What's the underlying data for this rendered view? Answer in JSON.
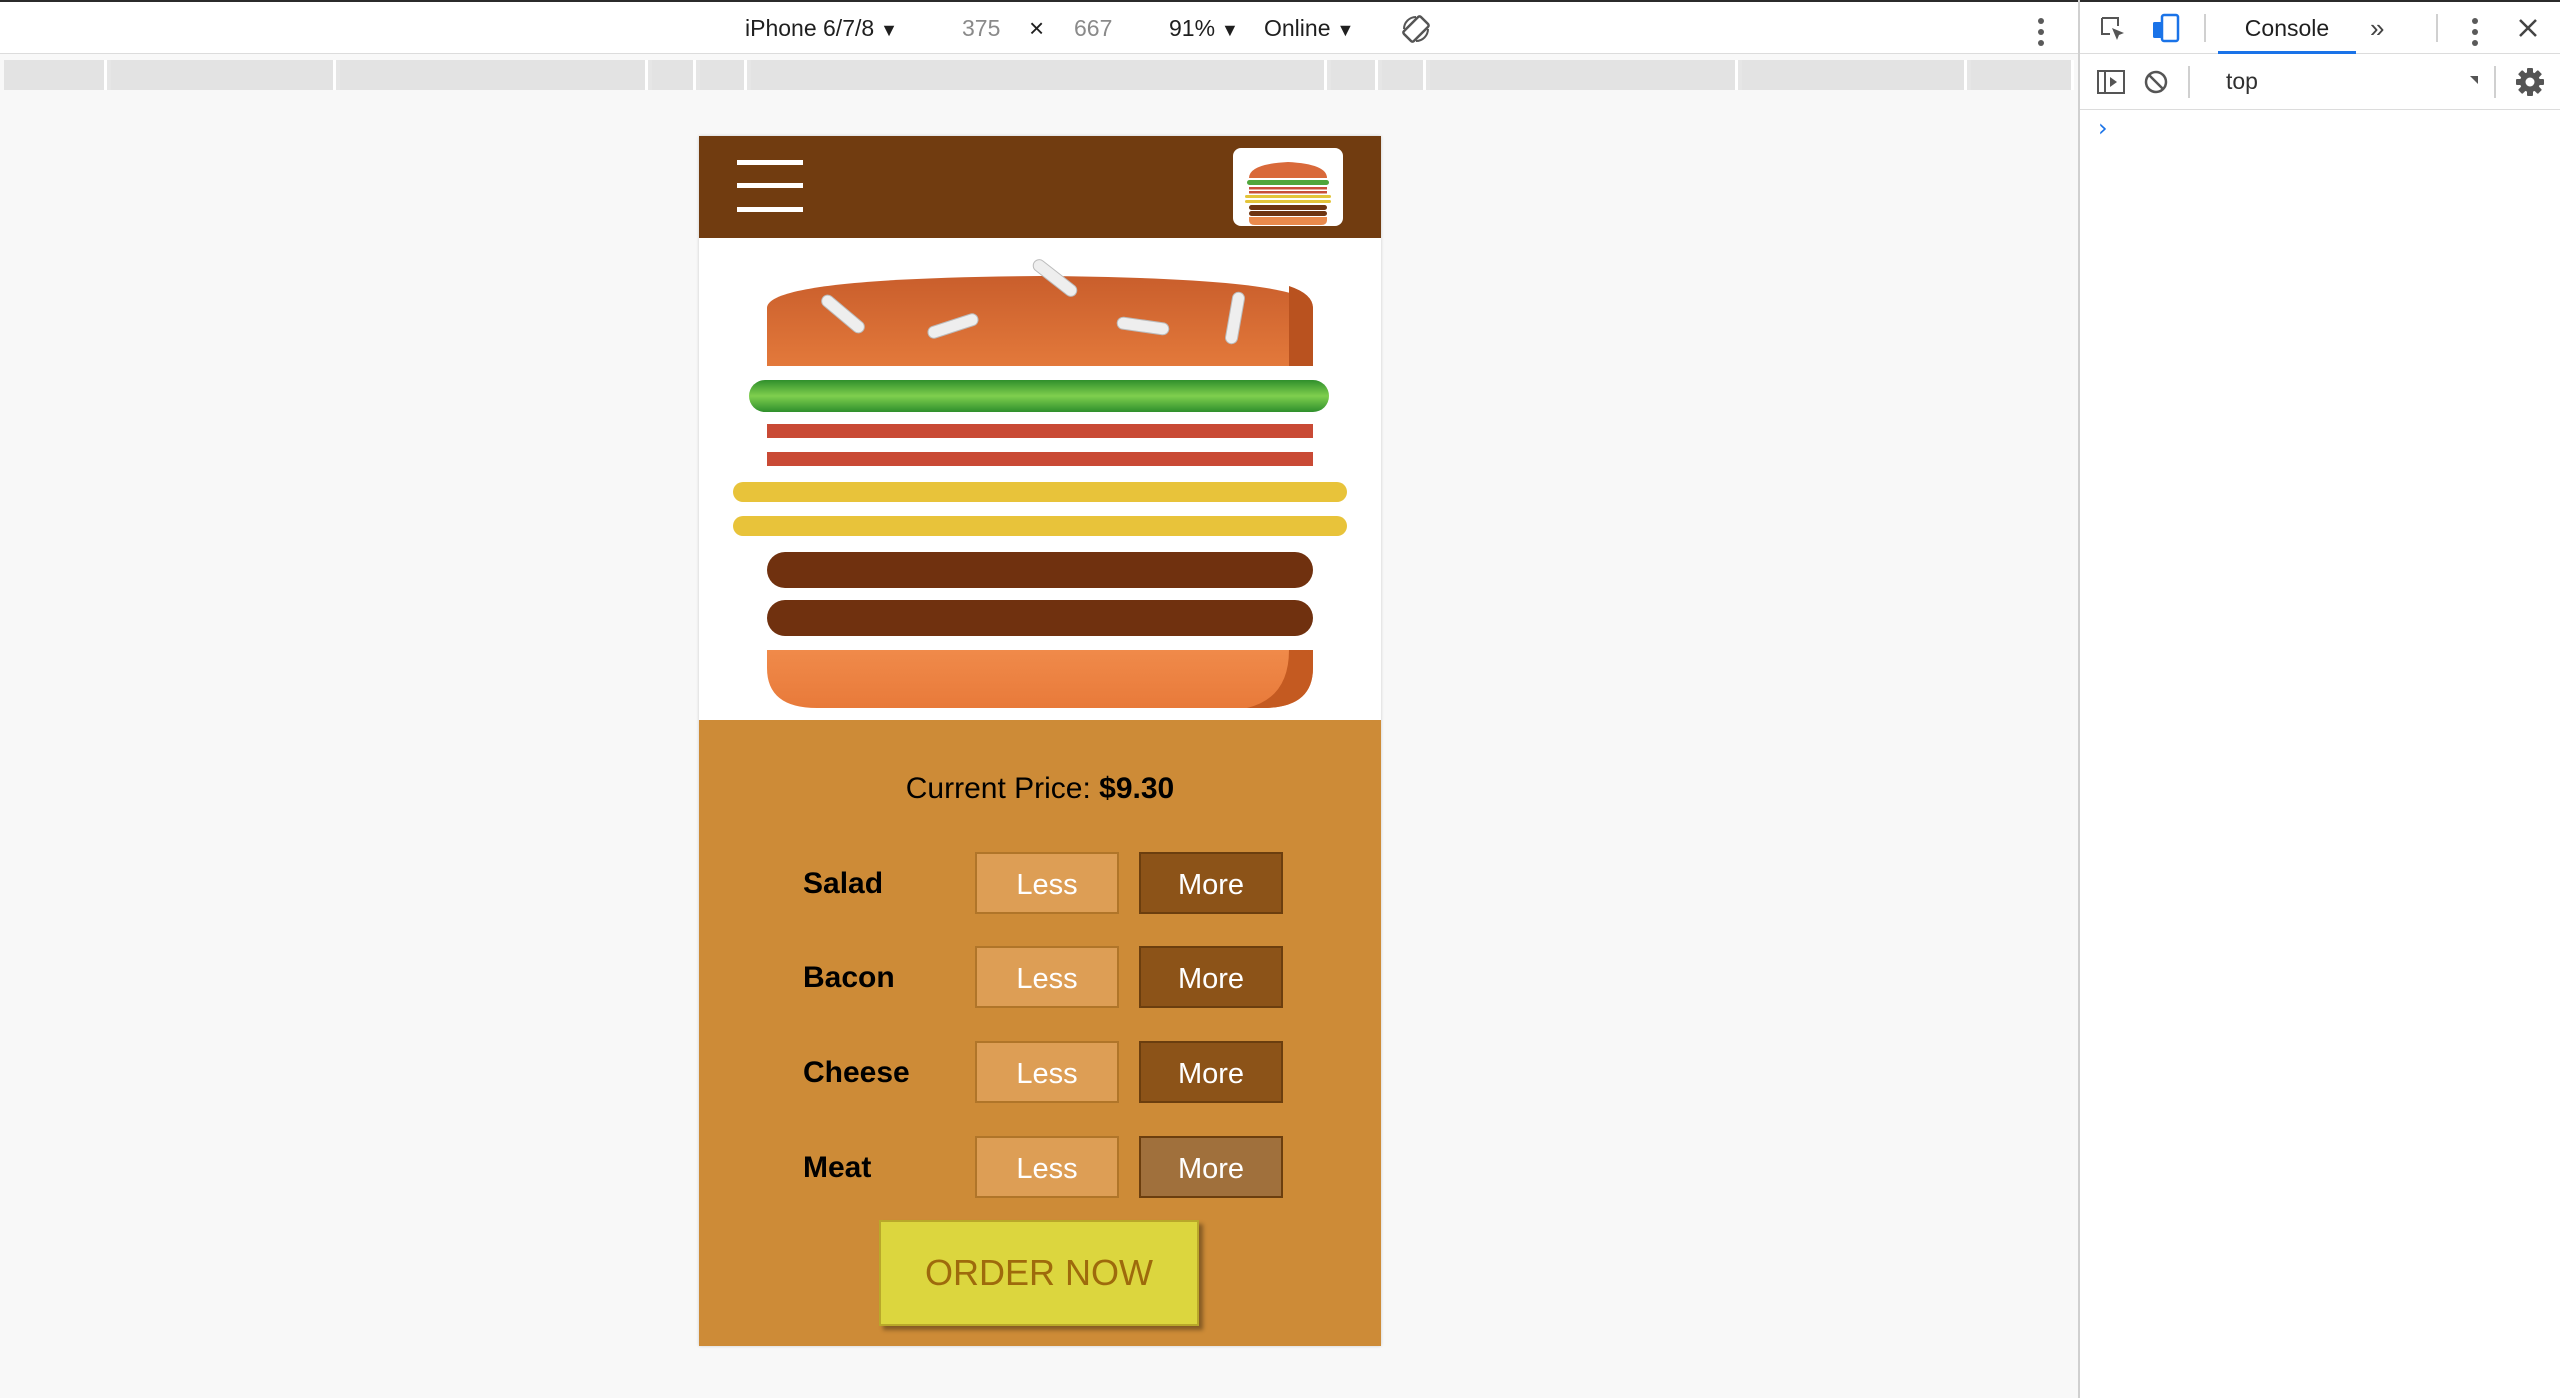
{
  "device_toolbar": {
    "device": "iPhone 6/7/8",
    "width": "375",
    "times": "×",
    "height": "667",
    "zoom": "91%",
    "network": "Online",
    "dropdown_glyph": "▼"
  },
  "app": {
    "header": {
      "menu_icon": "hamburger-menu-icon",
      "logo_icon": "burger-logo"
    },
    "price": {
      "label": "Current Price: ",
      "value": "$9.30"
    },
    "ingredients": [
      {
        "name": "Salad",
        "less": "Less",
        "more": "More"
      },
      {
        "name": "Bacon",
        "less": "Less",
        "more": "More"
      },
      {
        "name": "Cheese",
        "less": "Less",
        "more": "More"
      },
      {
        "name": "Meat",
        "less": "Less",
        "more": "More"
      }
    ],
    "order_button": "ORDER NOW",
    "burger_layers": [
      "bun-top",
      "salad",
      "bacon",
      "bacon",
      "cheese",
      "cheese",
      "meat",
      "meat",
      "bun-bottom"
    ]
  },
  "devtools": {
    "tab": "Console",
    "more_tabs": "»",
    "context": "top",
    "prompt": "›"
  },
  "colors": {
    "header": "#713c10",
    "panel": "#cd8b37",
    "less_button": "#dd9e55",
    "more_button": "#8c5318",
    "order_button": "#dcd63e",
    "accent": "#1a73e8"
  }
}
